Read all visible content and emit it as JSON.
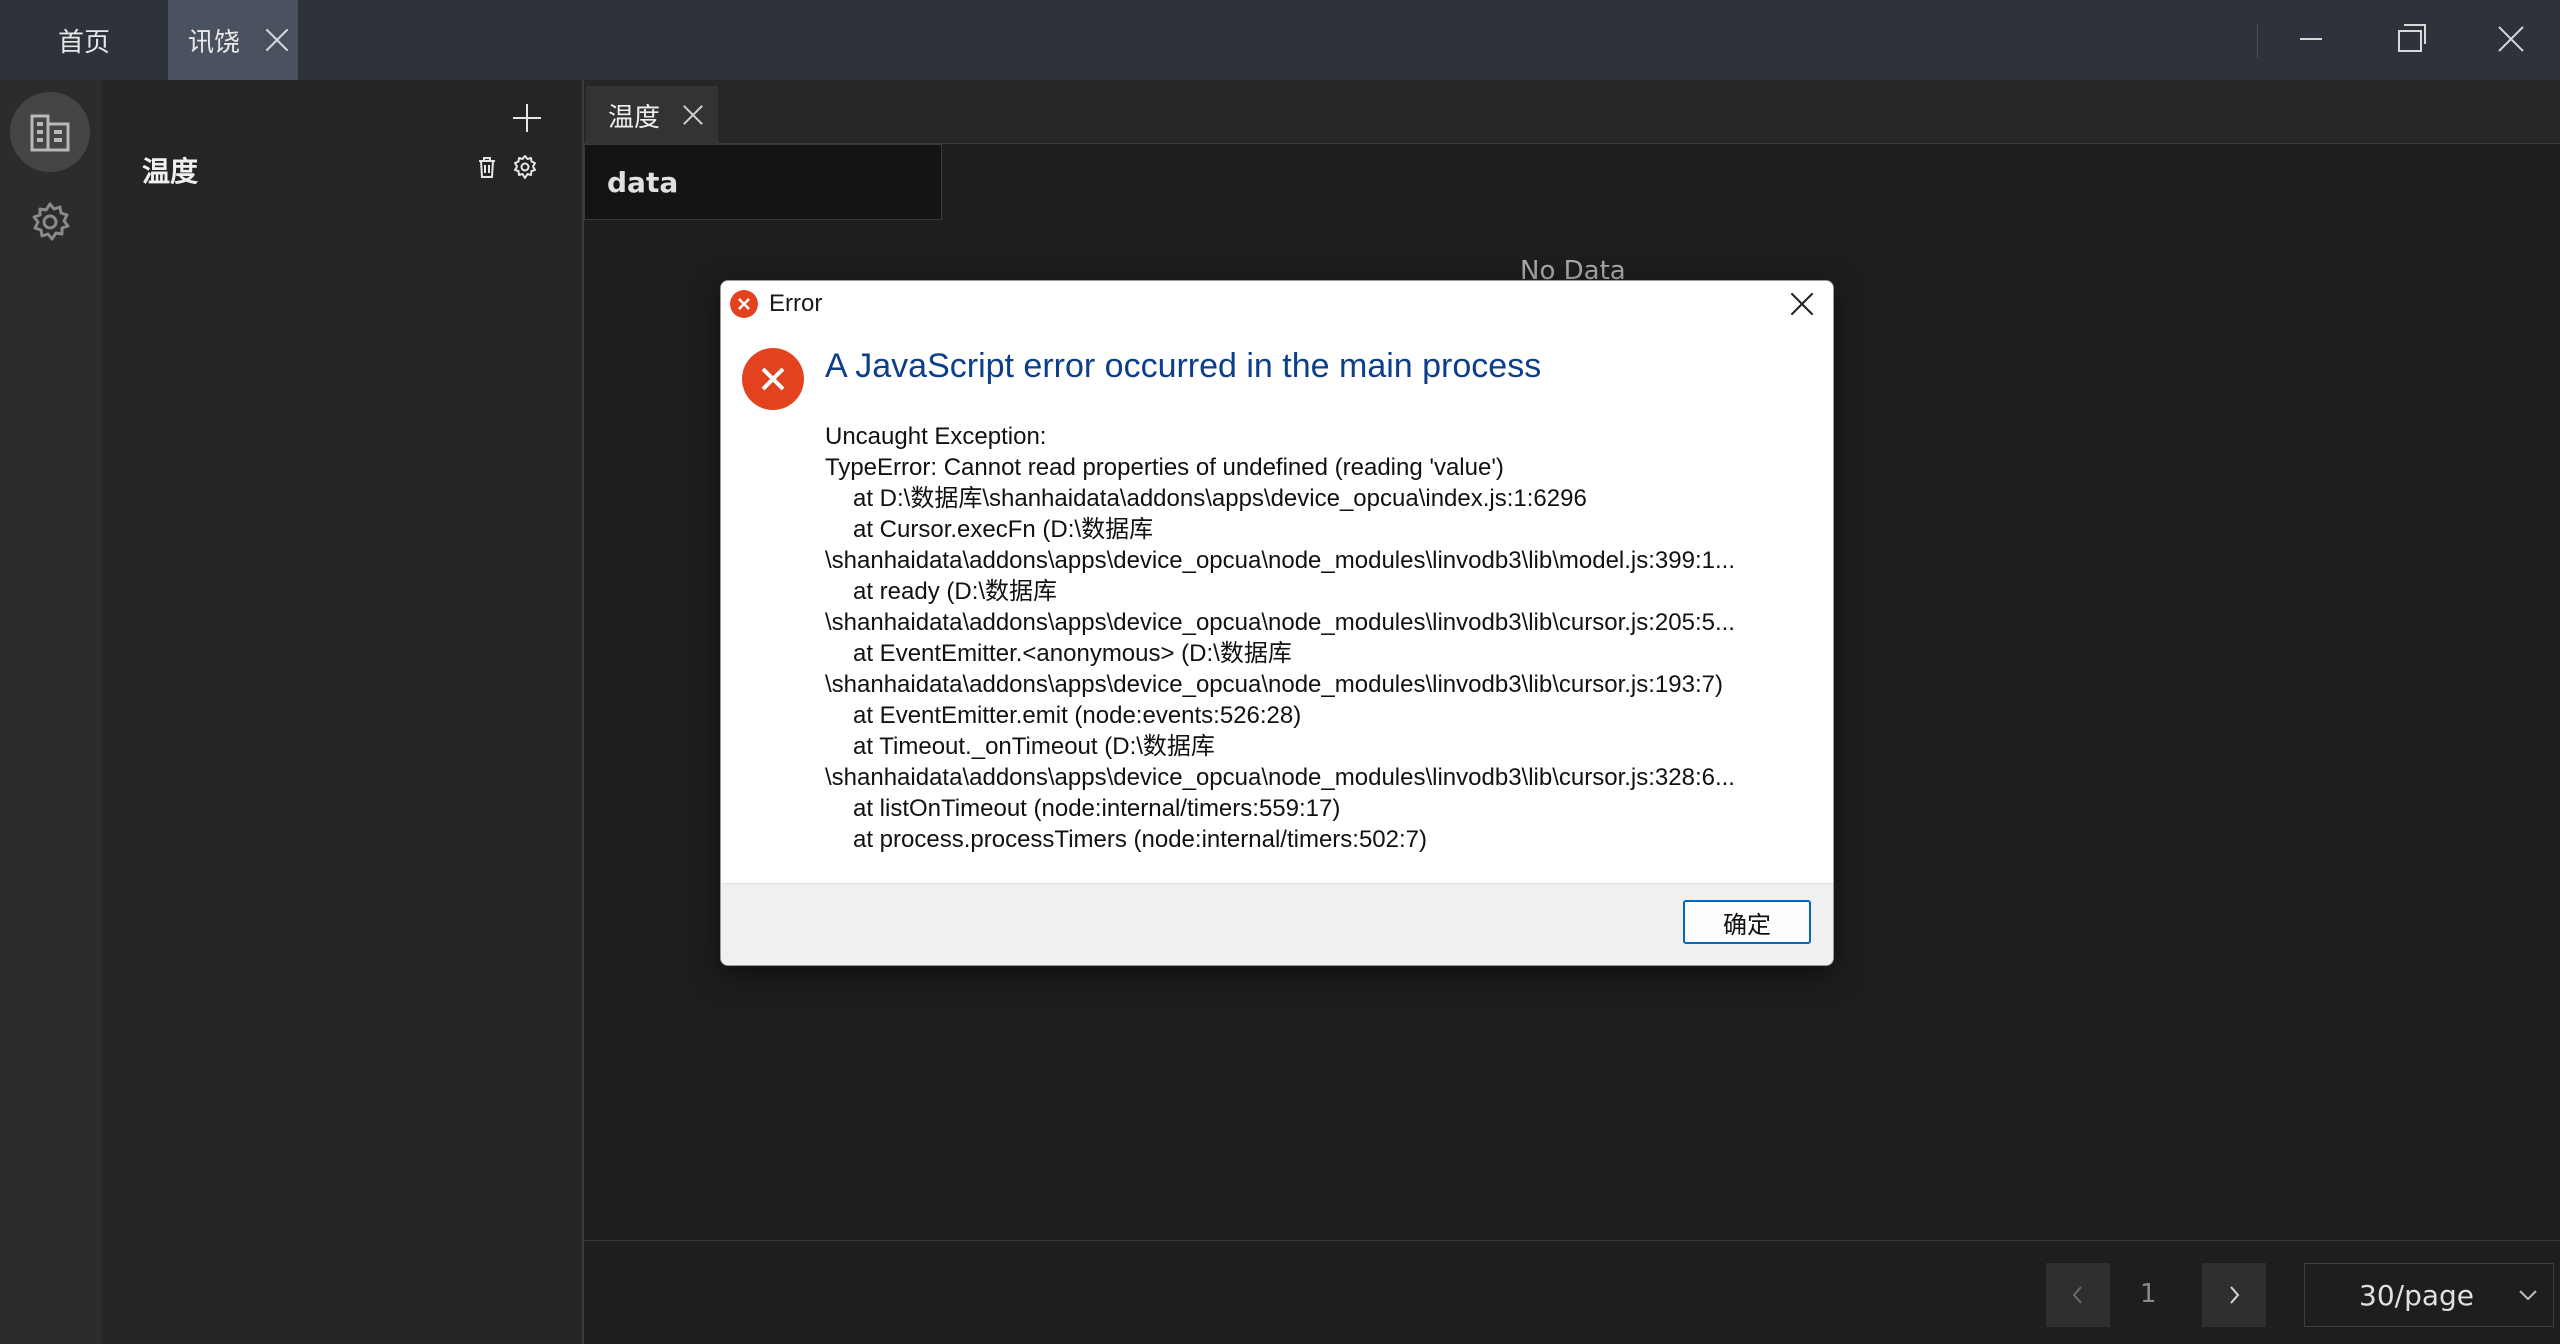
{
  "titlebar": {
    "tabs": [
      {
        "label": "首页"
      },
      {
        "label": "讯饶"
      }
    ]
  },
  "rail": {
    "items": [
      {
        "icon": "building-icon",
        "active": true
      },
      {
        "icon": "gear-icon",
        "active": false
      }
    ]
  },
  "sidebar": {
    "items": [
      {
        "label": "温度"
      }
    ]
  },
  "main": {
    "tabs": [
      {
        "label": "温度"
      }
    ],
    "table": {
      "columns": [
        "data"
      ],
      "empty_text": "No Data"
    },
    "pagination": {
      "current_page": "1",
      "page_size": "30/page"
    }
  },
  "dialog": {
    "title": "Error",
    "heading": "A JavaScript error occurred in the main process",
    "lines": [
      "Uncaught Exception:",
      "TypeError: Cannot read properties of undefined (reading 'value')",
      "at D:\\数据库\\shanhaidata\\addons\\apps\\device_opcua\\index.js:1:6296",
      "at Cursor.execFn (D:\\数据库",
      "\\shanhaidata\\addons\\apps\\device_opcua\\node_modules\\linvodb3\\lib\\model.js:399:1...",
      "at ready (D:\\数据库",
      "\\shanhaidata\\addons\\apps\\device_opcua\\node_modules\\linvodb3\\lib\\cursor.js:205:5...",
      "at EventEmitter.<anonymous> (D:\\数据库",
      "\\shanhaidata\\addons\\apps\\device_opcua\\node_modules\\linvodb3\\lib\\cursor.js:193:7)",
      "at EventEmitter.emit (node:events:526:28)",
      "at Timeout._onTimeout (D:\\数据库",
      "\\shanhaidata\\addons\\apps\\device_opcua\\node_modules\\linvodb3\\lib\\cursor.js:328:6...",
      "at listOnTimeout (node:internal/timers:559:17)",
      "at process.processTimers (node:internal/timers:502:7)"
    ],
    "ok_label": "确定"
  },
  "colors": {
    "titlebar_bg": "#2e323b",
    "active_tab_bg": "#4a5260",
    "error_red": "#e2431e",
    "heading_blue": "#0b3f8c",
    "ok_border": "#0067c0"
  }
}
